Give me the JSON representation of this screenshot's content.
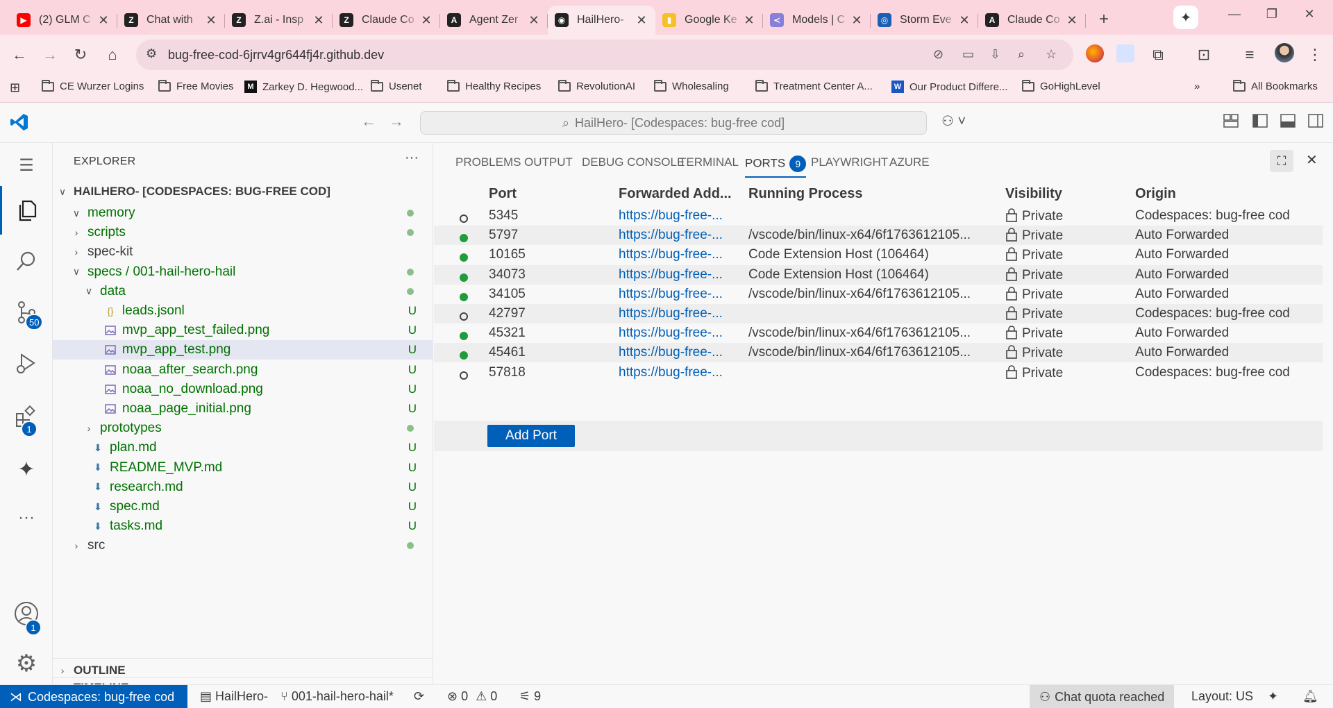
{
  "browser": {
    "tabs": [
      {
        "title": "(2) GLM C",
        "icon": "youtube-icon",
        "color": "#ff0000",
        "glyph": "▶",
        "active": false
      },
      {
        "title": "Chat with",
        "icon": "zai-icon",
        "color": "#222222",
        "glyph": "Z",
        "active": false
      },
      {
        "title": "Z.ai - Insp",
        "icon": "zai-icon",
        "color": "#222222",
        "glyph": "Z",
        "active": false
      },
      {
        "title": "Claude Co",
        "icon": "zai-icon",
        "color": "#222222",
        "glyph": "Z",
        "active": false
      },
      {
        "title": "Agent Zer",
        "icon": "agent-zero-icon",
        "color": "#222222",
        "glyph": "A",
        "active": false
      },
      {
        "title": "HailHero-",
        "icon": "github-icon",
        "color": "#222222",
        "glyph": "◉",
        "active": true
      },
      {
        "title": "Google Ke",
        "icon": "google-keep-icon",
        "color": "#f6c026",
        "glyph": "▮",
        "active": false
      },
      {
        "title": "Models | C",
        "icon": "models-icon",
        "color": "#8a7fd8",
        "glyph": "≺",
        "active": false
      },
      {
        "title": "Storm Eve",
        "icon": "noaa-icon",
        "color": "#1a5fb4",
        "glyph": "◎",
        "active": false
      },
      {
        "title": "Claude Co",
        "icon": "anthropic-icon",
        "color": "#222222",
        "glyph": "A",
        "active": false
      }
    ],
    "url": "bug-free-cod-6jrrv4gr644fj4r.github.dev",
    "bookmarks": [
      {
        "label": "CE Wurzer Logins",
        "kind": "folder"
      },
      {
        "label": "Free Movies",
        "kind": "folder"
      },
      {
        "label": "Zarkey D. Hegwood...",
        "kind": "logo",
        "glyph": "M",
        "color": "#111111"
      },
      {
        "label": "Usenet",
        "kind": "folder"
      },
      {
        "label": "Healthy Recipes",
        "kind": "folder"
      },
      {
        "label": "RevolutionAI",
        "kind": "folder"
      },
      {
        "label": "Wholesaling",
        "kind": "folder"
      },
      {
        "label": "Treatment Center A...",
        "kind": "folder"
      },
      {
        "label": "Our Product Differe...",
        "kind": "logo",
        "glyph": "W",
        "color": "#1a56c4"
      },
      {
        "label": "GoHighLevel",
        "kind": "folder"
      }
    ],
    "bookmarks_more": "»",
    "all_bookmarks": "All Bookmarks"
  },
  "vscode": {
    "command_center": "HailHero- [Codespaces: bug-free cod]",
    "activity": {
      "source_control_badge": "50",
      "extensions_badge": "1",
      "accounts_badge": "1"
    },
    "explorer": {
      "title": "EXPLORER",
      "more": "···",
      "root": "HAILHERO- [CODESPACES: BUG-FREE COD]",
      "items": [
        {
          "label": "memory",
          "chev": "∨",
          "icon": "",
          "status": "dot",
          "indent": 1,
          "plain": false
        },
        {
          "label": "scripts",
          "chev": "›",
          "icon": "",
          "status": "dot",
          "indent": 1,
          "plain": false
        },
        {
          "label": "spec-kit",
          "chev": "›",
          "icon": "",
          "status": "",
          "indent": 1,
          "plain": true
        },
        {
          "label": "specs / 001-hail-hero-hail",
          "chev": "∨",
          "icon": "",
          "status": "dot",
          "indent": 1,
          "plain": false
        },
        {
          "label": "data",
          "chev": "∨",
          "icon": "",
          "status": "dot",
          "indent": 2,
          "plain": false
        },
        {
          "label": "leads.jsonl",
          "chev": "",
          "icon": "json",
          "status": "U",
          "indent": 3,
          "plain": false
        },
        {
          "label": "mvp_app_test_failed.png",
          "chev": "",
          "icon": "image",
          "status": "U",
          "indent": 3,
          "plain": false
        },
        {
          "label": "mvp_app_test.png",
          "chev": "",
          "icon": "image",
          "status": "U",
          "indent": 3,
          "plain": false,
          "selected": true
        },
        {
          "label": "noaa_after_search.png",
          "chev": "",
          "icon": "image",
          "status": "U",
          "indent": 3,
          "plain": false
        },
        {
          "label": "noaa_no_download.png",
          "chev": "",
          "icon": "image",
          "status": "U",
          "indent": 3,
          "plain": false
        },
        {
          "label": "noaa_page_initial.png",
          "chev": "",
          "icon": "image",
          "status": "U",
          "indent": 3,
          "plain": false
        },
        {
          "label": "prototypes",
          "chev": "›",
          "icon": "",
          "status": "dot",
          "indent": 2,
          "plain": false
        },
        {
          "label": "plan.md",
          "chev": "",
          "icon": "md",
          "status": "U",
          "indent": 2,
          "plain": false
        },
        {
          "label": "README_MVP.md",
          "chev": "",
          "icon": "md",
          "status": "U",
          "indent": 2,
          "plain": false
        },
        {
          "label": "research.md",
          "chev": "",
          "icon": "md",
          "status": "U",
          "indent": 2,
          "plain": false
        },
        {
          "label": "spec.md",
          "chev": "",
          "icon": "md",
          "status": "U",
          "indent": 2,
          "plain": false
        },
        {
          "label": "tasks.md",
          "chev": "",
          "icon": "md",
          "status": "U",
          "indent": 2,
          "plain": false
        },
        {
          "label": "src",
          "chev": "›",
          "icon": "",
          "status": "dot",
          "indent": 1,
          "plain": true
        }
      ],
      "outline": "OUTLINE",
      "timeline": "TIMELINE"
    },
    "panel": {
      "tabs": [
        "PROBLEMS",
        "OUTPUT",
        "DEBUG CONSOLE",
        "TERMINAL",
        "PORTS",
        "PLAYWRIGHT",
        "AZURE"
      ],
      "active_tab": "PORTS",
      "ports_badge": "9",
      "columns": [
        "Port",
        "Forwarded Add...",
        "Running Process",
        "Visibility",
        "Origin"
      ],
      "rows": [
        {
          "running": false,
          "port": "5345",
          "address": "https://bug-free-...",
          "process": "",
          "visibility": "Private",
          "origin": "Codespaces: bug-free cod"
        },
        {
          "running": true,
          "port": "5797",
          "address": "https://bug-free-...",
          "process": "/vscode/bin/linux-x64/6f1763612105...",
          "visibility": "Private",
          "origin": "Auto Forwarded"
        },
        {
          "running": true,
          "port": "10165",
          "address": "https://bug-free-...",
          "process": "Code Extension Host (106464)",
          "visibility": "Private",
          "origin": "Auto Forwarded"
        },
        {
          "running": true,
          "port": "34073",
          "address": "https://bug-free-...",
          "process": "Code Extension Host (106464)",
          "visibility": "Private",
          "origin": "Auto Forwarded"
        },
        {
          "running": true,
          "port": "34105",
          "address": "https://bug-free-...",
          "process": "/vscode/bin/linux-x64/6f1763612105...",
          "visibility": "Private",
          "origin": "Auto Forwarded"
        },
        {
          "running": false,
          "port": "42797",
          "address": "https://bug-free-...",
          "process": "",
          "visibility": "Private",
          "origin": "Codespaces: bug-free cod"
        },
        {
          "running": true,
          "port": "45321",
          "address": "https://bug-free-...",
          "process": "/vscode/bin/linux-x64/6f1763612105...",
          "visibility": "Private",
          "origin": "Auto Forwarded"
        },
        {
          "running": true,
          "port": "45461",
          "address": "https://bug-free-...",
          "process": "/vscode/bin/linux-x64/6f1763612105...",
          "visibility": "Private",
          "origin": "Auto Forwarded"
        },
        {
          "running": false,
          "port": "57818",
          "address": "https://bug-free-...",
          "process": "",
          "visibility": "Private",
          "origin": "Codespaces: bug-free cod"
        }
      ],
      "add_port": "Add Port"
    },
    "statusbar": {
      "remote": "Codespaces: bug-free cod",
      "repo": "HailHero-",
      "branch": "001-hail-hero-hail*",
      "errors": "0",
      "warnings": "0",
      "ports": "9",
      "chat_quota": "Chat quota reached",
      "layout": "Layout: US"
    }
  },
  "colors": {
    "accent": "#005fb8",
    "git_added": "#007100",
    "running_dot": "#1f9d3d",
    "chrome_frame": "#fbd6df"
  }
}
